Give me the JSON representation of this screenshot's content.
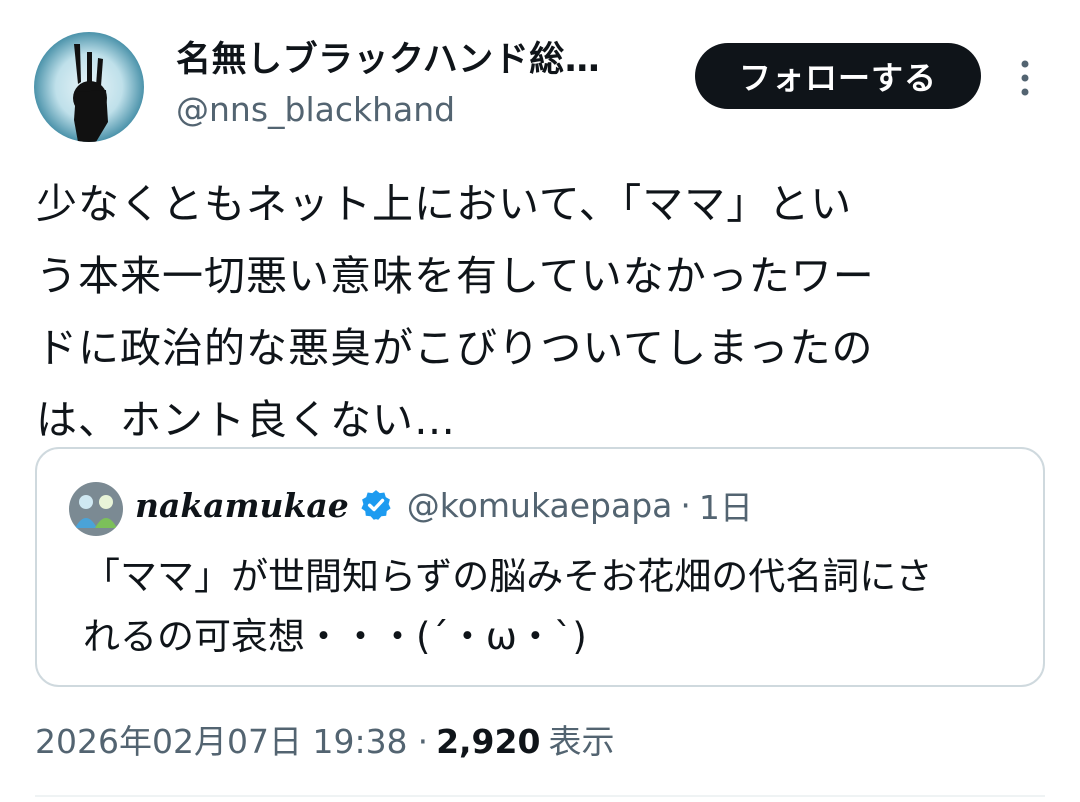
{
  "author": {
    "display_name": "名無しブラックハンド総…",
    "handle": "@nns_blackhand",
    "avatar_icon": "ok-hand-gesture-icon"
  },
  "actions": {
    "follow_label": "フォローする",
    "more_icon": "more-vertical-icon"
  },
  "tweet": {
    "text": "少なくともネット上において、「ママ」とい\nう本来一切悪い意味を有していなかったワー\nドに政治的な悪臭がこびりついてしまったの\nは、ホント良くない…"
  },
  "quote": {
    "display_name": "nakamukae",
    "handle": "@komukaepapa",
    "separator": "·",
    "time": "1日",
    "verified_icon": "verified-badge-icon",
    "text": "「ママ」が世間知らずの脳みそお花畑の代名詞にさ\nれるの可哀想・・・(´・ω・`)"
  },
  "meta": {
    "timestamp": "2026年02月07日 19:38",
    "separator": "·",
    "views_count": "2,920",
    "views_label": "表示"
  },
  "colors": {
    "primary_text": "#0f1419",
    "secondary_text": "#536471",
    "border": "#cfd9de",
    "verified": "#1d9bf0",
    "button_bg": "#0f1419"
  }
}
